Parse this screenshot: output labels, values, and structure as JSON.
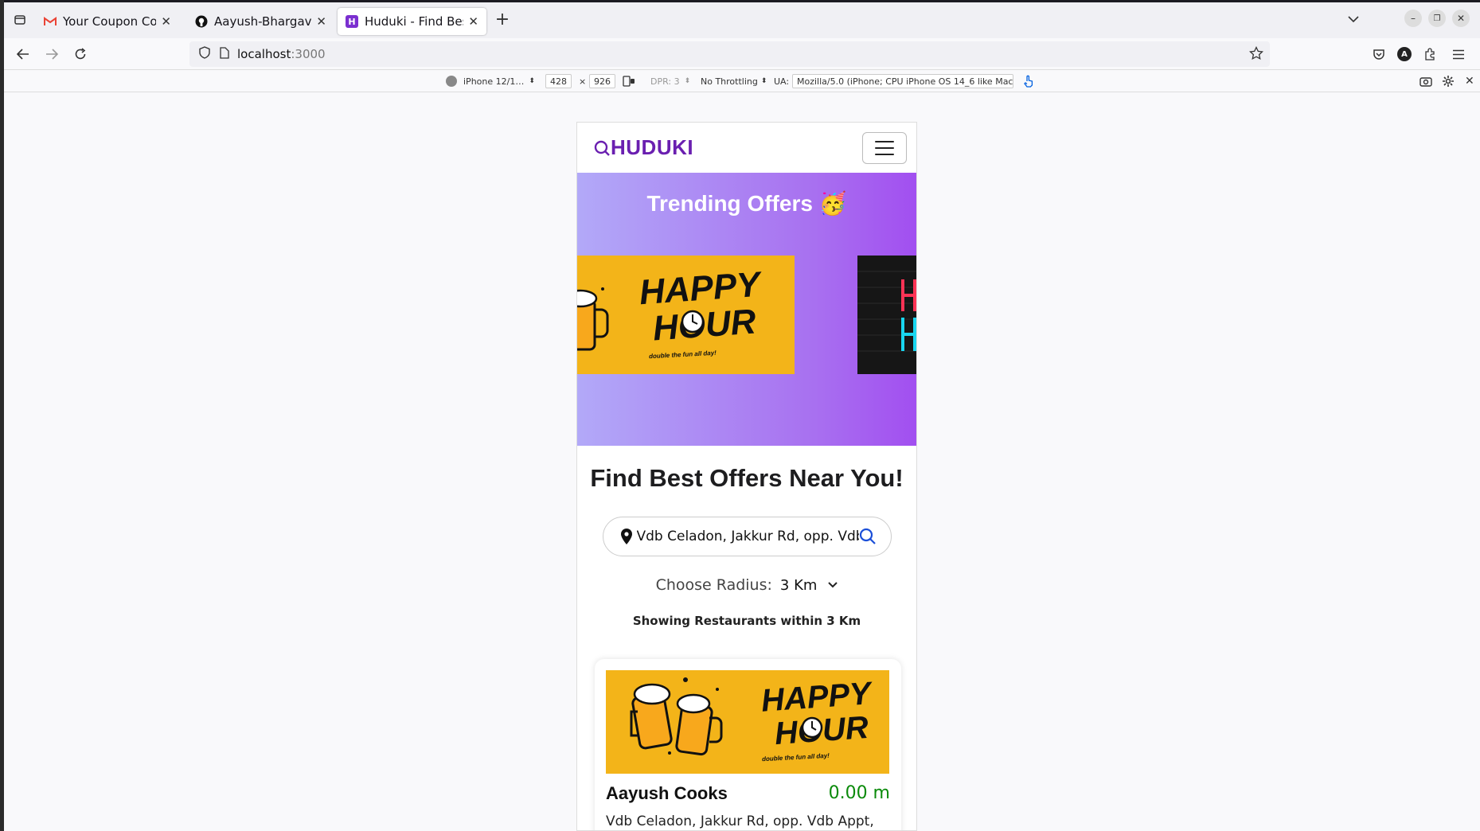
{
  "browser": {
    "tabs": [
      {
        "title": "Your Coupon Code - aayus",
        "favicon": "gmail-icon",
        "active": false
      },
      {
        "title": "Aayush-Bhargav/Huduki-F",
        "favicon": "github-icon",
        "active": false
      },
      {
        "title": "Huduki - Find Best Offers",
        "favicon": "huduki-icon",
        "active": true
      }
    ],
    "url_host": "localhost",
    "url_port": ":3000"
  },
  "rdm": {
    "device": "iPhone 12/1…",
    "width": "428",
    "times": "×",
    "height": "926",
    "dpr": "DPR: 3",
    "throttling": "No Throttling",
    "ua_label": "UA:",
    "ua_value": "Mozilla/5.0 (iPhone; CPU iPhone OS 14_6 like Mac"
  },
  "app": {
    "brand": "HUDUKI",
    "trending_title": "Trending Offers 🥳",
    "slide_hh_line1": "HAPPY",
    "slide_hh_line2": "HOUR",
    "slide_hh_sub": "double the fun all day!",
    "find_title": "Find Best Offers Near You!",
    "search_value": "Vdb Celadon, Jakkur Rd, opp. Vdb Appt,",
    "radius_label": "Choose Radius:",
    "radius_value": "3 Km",
    "showing_text": "Showing Restaurants within 3 Km",
    "restaurants": [
      {
        "name": "Aayush Cooks",
        "distance": "0.00 m",
        "address": "Vdb Celadon, Jakkur Rd, opp. Vdb Appt,"
      }
    ]
  },
  "colors": {
    "brand": "#6a1fb0",
    "distance": "#0a8a0a",
    "banner": "#f3b419"
  }
}
